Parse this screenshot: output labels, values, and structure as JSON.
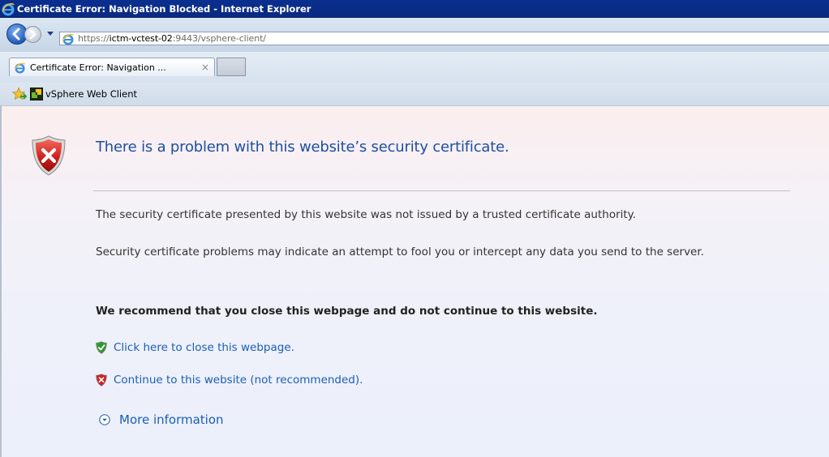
{
  "window": {
    "title": "Certificate Error: Navigation Blocked - Internet Explorer",
    "app_icon": "ie-icon"
  },
  "address_bar": {
    "url_prefix": "https://",
    "url_host": "ictm-vctest-02",
    "url_suffix": ":9443/vsphere-client/"
  },
  "tabs": [
    {
      "label": "Certificate Error: Navigation ...",
      "close": "×"
    }
  ],
  "favorites": {
    "star_icon": "favorites-star-icon",
    "items": [
      {
        "label": "vSphere Web Client",
        "icon": "vsphere-icon"
      }
    ]
  },
  "content": {
    "heading": "There is a problem with this website’s security certificate.",
    "paragraph_1": "The security certificate presented by this website was not issued by a trusted certificate authority.",
    "paragraph_2": "Security certificate problems may indicate an attempt to fool you or intercept any data you send to the server.",
    "recommendation": "We recommend that you close this webpage and do not continue to this website.",
    "close_link": "Click here to close this webpage.",
    "continue_link": "Continue to this website (not recommended).",
    "more_info": "More information"
  },
  "colors": {
    "title_bar": "#0b2f8f",
    "heading": "#1f4fa0",
    "link": "#1a5eb4",
    "shield_red": "#d02020",
    "shield_green": "#2e9a2e"
  }
}
